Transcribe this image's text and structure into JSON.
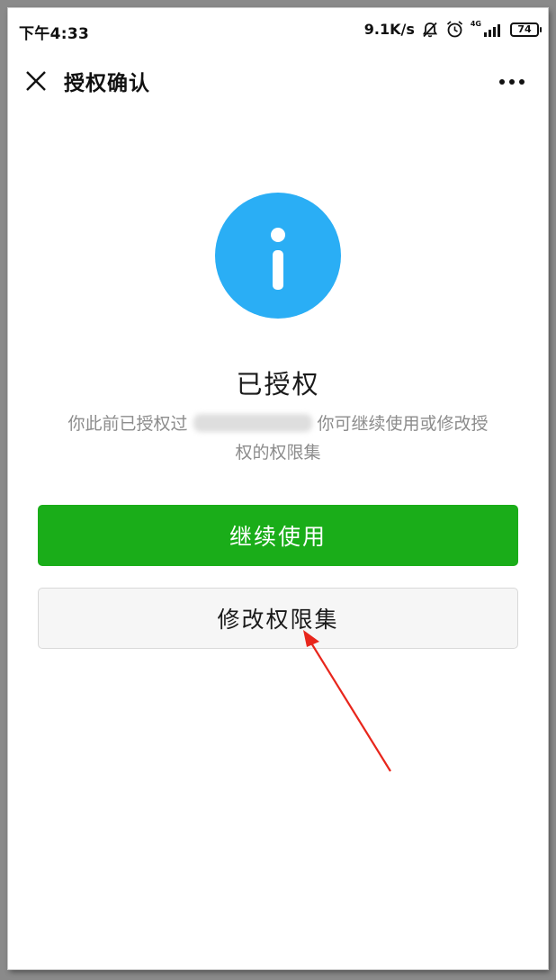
{
  "status_bar": {
    "time": "下午4:33",
    "net_speed": "9.1K/s",
    "network_type": "4G",
    "battery": "74",
    "icons": [
      "mute-bell-icon",
      "alarm-icon",
      "signal-icon",
      "battery-icon"
    ]
  },
  "nav": {
    "title": "授权确认",
    "close_icon": "close-icon",
    "more_icon": "more-icon"
  },
  "main": {
    "icon": "info-icon",
    "status_title": "已授权",
    "description_part1": "你此前已授权过",
    "description_part2": "你可继续使用或修改授权的权限集",
    "primary_button": "继续使用",
    "secondary_button": "修改权限集"
  },
  "colors": {
    "primary_green": "#1aad19",
    "info_blue": "#2aaef5",
    "annotation_red": "#e8261c"
  }
}
